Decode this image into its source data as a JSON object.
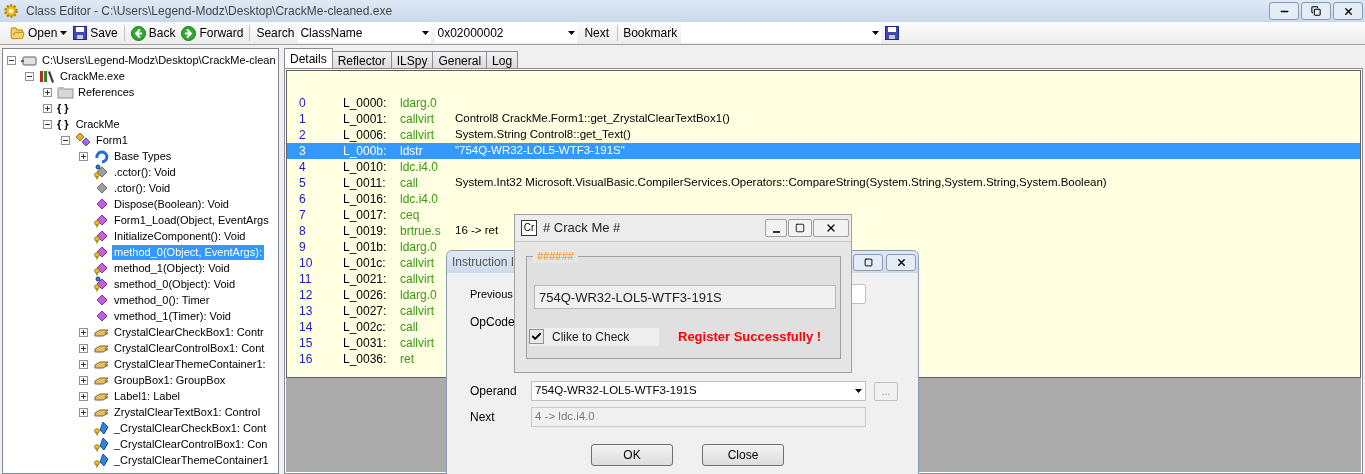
{
  "window": {
    "title": "Class Editor - C:\\Users\\Legend-Modz\\Desktop\\CrackMe-cleaned.exe"
  },
  "toolbar": {
    "open": "Open",
    "save": "Save",
    "back": "Back",
    "forward": "Forward",
    "search_label": "Search",
    "search_type": "ClassName",
    "search_value": "0x02000002",
    "next": "Next",
    "bookmark_label": "Bookmark"
  },
  "tree": [
    {
      "label": "C:\\Users\\Legend-Modz\\Desktop\\CrackMe-clean",
      "kind": "file",
      "expanded": true,
      "selected": false,
      "children": [
        {
          "label": "CrackMe.exe",
          "kind": "assembly",
          "expanded": true,
          "selected": false,
          "children": [
            {
              "label": "References",
              "kind": "references",
              "expanded": false,
              "selected": false
            },
            {
              "glyph": "{ }",
              "kind": "namespace",
              "expanded": false,
              "selected": false
            },
            {
              "glyph": "{ }",
              "label": "CrackMe",
              "kind": "namespace",
              "expanded": true,
              "selected": false,
              "children": [
                {
                  "label": "Form1",
                  "kind": "class",
                  "expanded": true,
                  "selected": false,
                  "children": [
                    {
                      "label": "Base Types",
                      "kind": "basetypes",
                      "expanded": false,
                      "selected": false
                    },
                    {
                      "label": ".cctor(): Void",
                      "kind": "constructor",
                      "private": true,
                      "static": true,
                      "selected": false
                    },
                    {
                      "label": ".ctor(): Void",
                      "kind": "constructor",
                      "private": false,
                      "static": false,
                      "selected": false
                    },
                    {
                      "label": "Dispose(Boolean): Void",
                      "kind": "method",
                      "private": false,
                      "static": false,
                      "selected": false
                    },
                    {
                      "label": "Form1_Load(Object, EventArgs",
                      "kind": "method",
                      "private": true,
                      "static": false,
                      "selected": false
                    },
                    {
                      "label": "InitializeComponent(): Void",
                      "kind": "method",
                      "private": true,
                      "static": false,
                      "selected": false
                    },
                    {
                      "label": "method_0(Object, EventArgs):",
                      "kind": "method",
                      "private": true,
                      "static": false,
                      "selected": true
                    },
                    {
                      "label": "method_1(Object): Void",
                      "kind": "method",
                      "private": true,
                      "static": false,
                      "selected": false
                    },
                    {
                      "label": "smethod_0(Object): Void",
                      "kind": "method",
                      "private": true,
                      "static": true,
                      "selected": false
                    },
                    {
                      "label": "vmethod_0(): Timer",
                      "kind": "method",
                      "private": false,
                      "static": false,
                      "selected": false
                    },
                    {
                      "label": "vmethod_1(Timer): Void",
                      "kind": "method",
                      "private": false,
                      "static": false,
                      "selected": false
                    },
                    {
                      "label": "CrystalClearCheckBox1: Contr",
                      "kind": "property",
                      "expanded": false,
                      "selected": false
                    },
                    {
                      "label": "CrystalClearControlBox1: Cont",
                      "kind": "property",
                      "expanded": false,
                      "selected": false
                    },
                    {
                      "label": "CrystalClearThemeContainer1:",
                      "kind": "property",
                      "expanded": false,
                      "selected": false
                    },
                    {
                      "label": "GroupBox1: GroupBox",
                      "kind": "property",
                      "expanded": false,
                      "selected": false
                    },
                    {
                      "label": "Label1: Label",
                      "kind": "property",
                      "expanded": false,
                      "selected": false
                    },
                    {
                      "label": "ZrystalClearTextBox1: Control",
                      "kind": "property",
                      "expanded": false,
                      "selected": false
                    },
                    {
                      "label": "_CrystalClearCheckBox1: Cont",
                      "kind": "field",
                      "private": true,
                      "static": false,
                      "selected": false
                    },
                    {
                      "label": "_CrystalClearControlBox1: Con",
                      "kind": "field",
                      "private": true,
                      "static": false,
                      "selected": false
                    },
                    {
                      "label": "_CrystalClearThemeContainer1",
                      "kind": "field",
                      "private": true,
                      "static": false,
                      "selected": false
                    }
                  ]
                }
              ]
            }
          ]
        }
      ]
    }
  ],
  "tabs": [
    {
      "label": "Details",
      "selected": true
    },
    {
      "label": "Reflector",
      "selected": false
    },
    {
      "label": "ILSpy",
      "selected": false
    },
    {
      "label": "General",
      "selected": false
    },
    {
      "label": "Log",
      "selected": false
    }
  ],
  "code": [
    {
      "index": "0",
      "offset": "L_0000:",
      "opcode": "ldarg.0",
      "selected": false
    },
    {
      "index": "1",
      "offset": "L_0001:",
      "opcode": "callvirt",
      "operand": "Control8 CrackMe.Form1::get_ZrystalClearTextBox1()",
      "selected": false
    },
    {
      "index": "2",
      "offset": "L_0006:",
      "opcode": "callvirt",
      "operand": "System.String Control8::get_Text()",
      "selected": false
    },
    {
      "index": "3",
      "offset": "L_000b:",
      "opcode": "ldstr",
      "operand": "\"754Q-WR32-LOL5-WTF3-191S\"",
      "selected": true
    },
    {
      "index": "4",
      "offset": "L_0010:",
      "opcode": "ldc.i4.0",
      "selected": false
    },
    {
      "index": "5",
      "offset": "L_0011:",
      "opcode": "call",
      "operand": "System.Int32 Microsoft.VisualBasic.CompilerServices.Operators::CompareString(System.String,System.String,System.Boolean)",
      "selected": false
    },
    {
      "index": "6",
      "offset": "L_0016:",
      "opcode": "ldc.i4.0",
      "selected": false
    },
    {
      "index": "7",
      "offset": "L_0017:",
      "opcode": "ceq",
      "selected": false
    },
    {
      "index": "8",
      "offset": "L_0019:",
      "opcode": "brtrue.s",
      "operand": "16 -> ret",
      "selected": false
    },
    {
      "index": "9",
      "offset": "L_001b:",
      "opcode": "ldarg.0",
      "selected": false
    },
    {
      "index": "10",
      "offset": "L_001c:",
      "opcode": "callvirt",
      "selected": false
    },
    {
      "index": "11",
      "offset": "L_0021:",
      "opcode": "callvirt",
      "selected": false
    },
    {
      "index": "12",
      "offset": "L_0026:",
      "opcode": "ldarg.0",
      "selected": false
    },
    {
      "index": "13",
      "offset": "L_0027:",
      "opcode": "callvirt",
      "selected": false
    },
    {
      "index": "14",
      "offset": "L_002c:",
      "opcode": "call",
      "selected": false
    },
    {
      "index": "15",
      "offset": "L_0031:",
      "opcode": "callvirt",
      "selected": false
    },
    {
      "index": "16",
      "offset": "L_0036:",
      "opcode": "ret",
      "selected": false
    }
  ],
  "instruction_dialog": {
    "title": "Instruction I",
    "previous_label": "Previous",
    "opcode_label": "OpCode",
    "operand_label": "Operand",
    "operand_value": "754Q-WR32-LOL5-WTF3-191S",
    "browse": "...",
    "next_label": "Next",
    "next_value": "4 -> ldc.i4.0",
    "ok": "OK",
    "close": "Close"
  },
  "crackme": {
    "icon_label": "Cr",
    "title": "# Crack Me #",
    "group_title": "######",
    "serial": "754Q-WR32-LOL5-WTF3-191S",
    "checkbox_label": "Clike to Check",
    "checked": true,
    "message": "Register Successfully !"
  }
}
